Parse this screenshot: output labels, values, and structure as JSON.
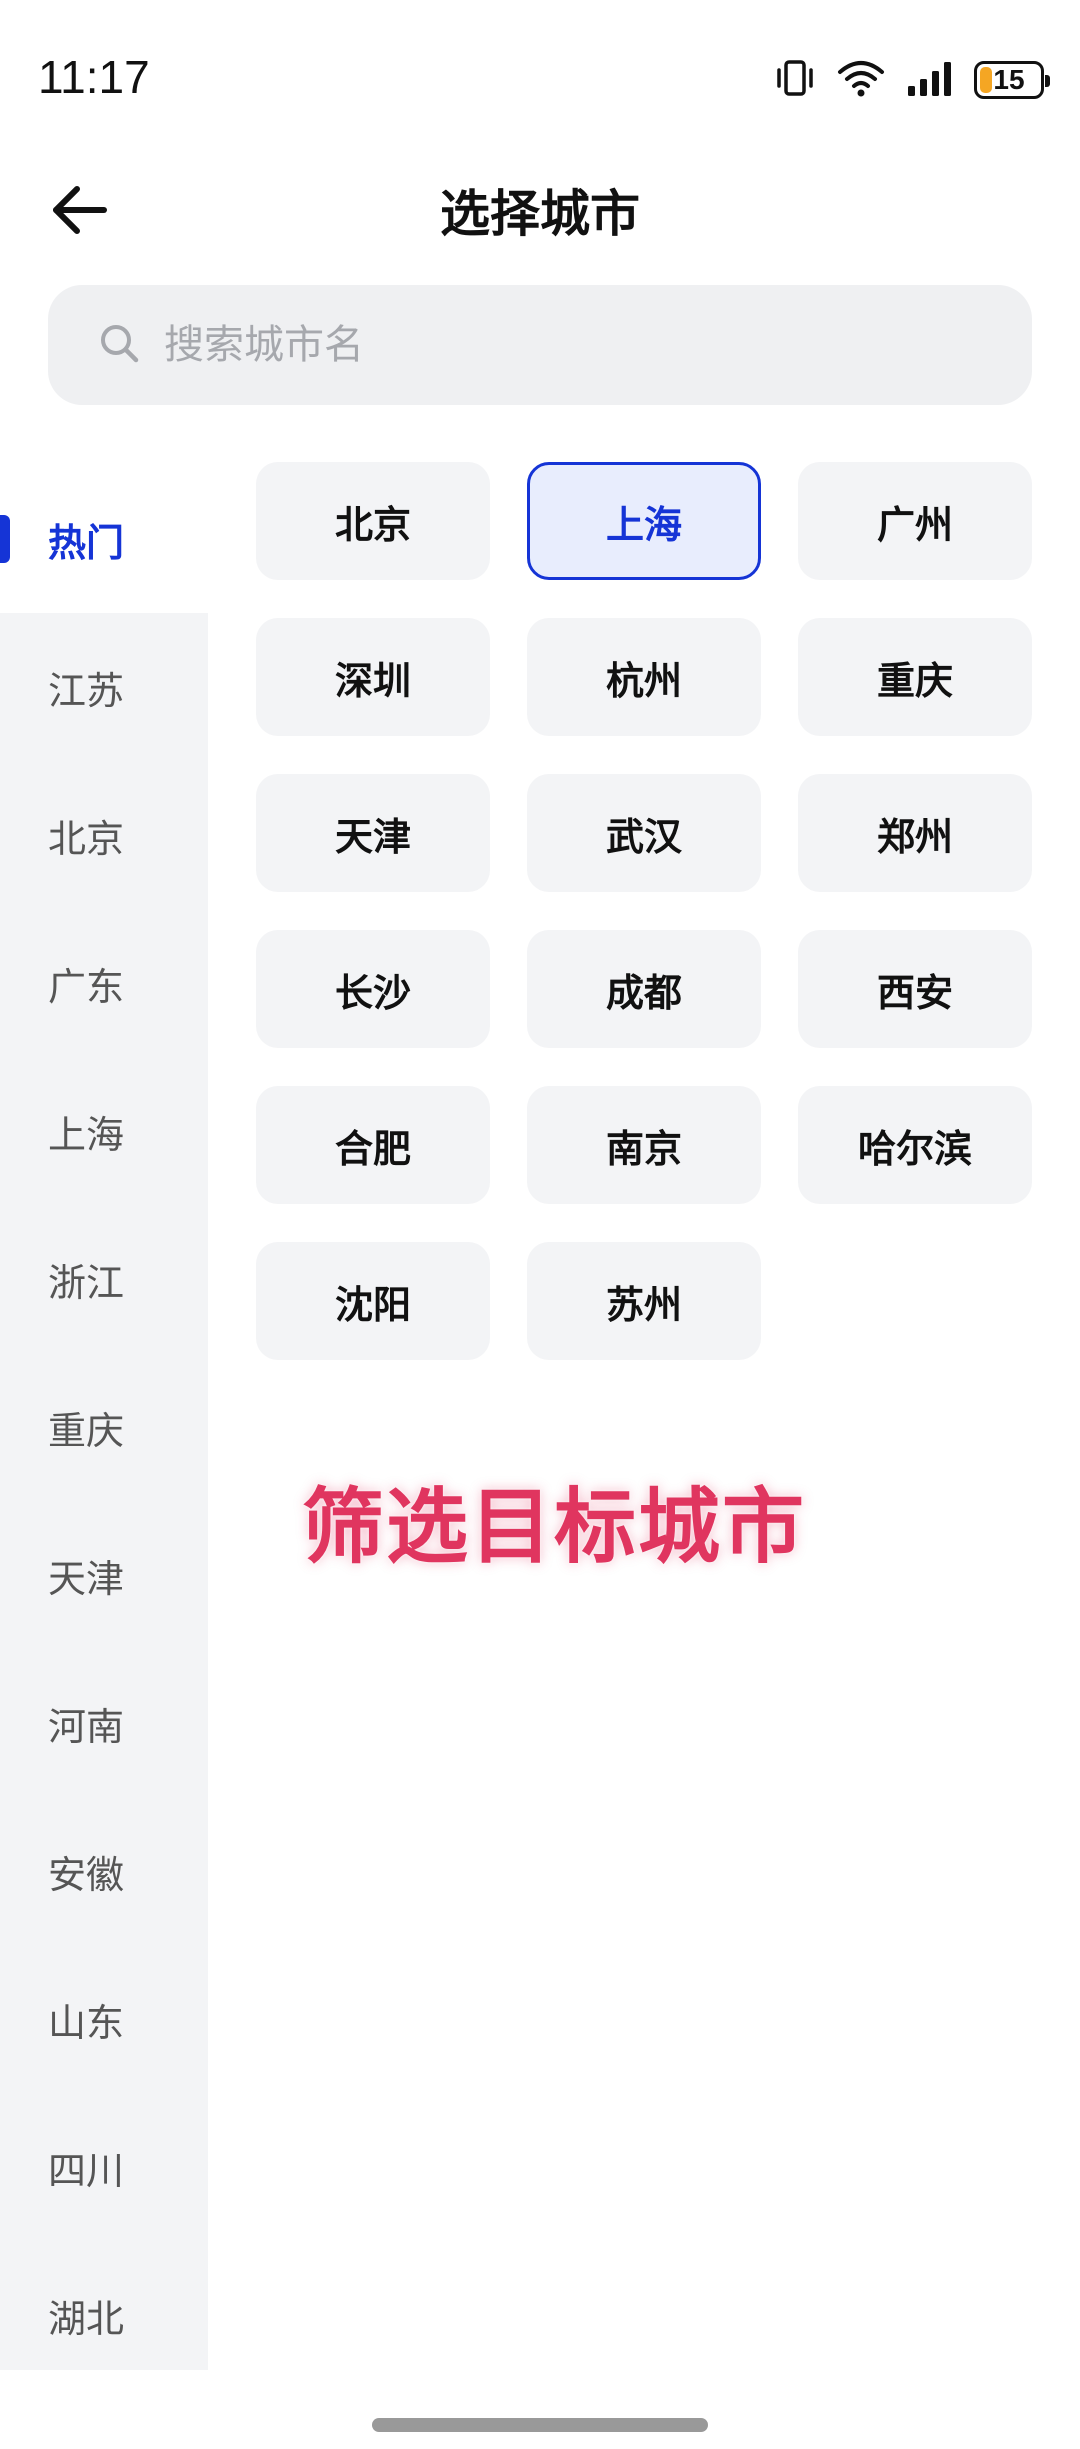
{
  "status_bar": {
    "time": "11:17",
    "battery_level": "15",
    "battery_color": "#f5a623",
    "icons": [
      "vibrate-icon",
      "wifi-icon",
      "signal-icon",
      "battery-icon"
    ]
  },
  "header": {
    "title": "选择城市",
    "back_icon": "arrow-left-icon"
  },
  "search": {
    "placeholder": "搜索城市名",
    "value": "",
    "icon": "search-icon"
  },
  "sidebar": {
    "active_index": 0,
    "accent_color": "#1534d6",
    "items": [
      "热门",
      "江苏",
      "北京",
      "广东",
      "上海",
      "浙江",
      "重庆",
      "天津",
      "河南",
      "安徽",
      "山东",
      "四川",
      "湖北"
    ]
  },
  "cities": {
    "selected": "上海",
    "items": [
      "北京",
      "上海",
      "广州",
      "深圳",
      "杭州",
      "重庆",
      "天津",
      "武汉",
      "郑州",
      "长沙",
      "成都",
      "西安",
      "合肥",
      "南京",
      "哈尔滨",
      "沈阳",
      "苏州"
    ]
  },
  "overlay": {
    "caption": "筛选目标城市",
    "color": "#e0355f"
  }
}
